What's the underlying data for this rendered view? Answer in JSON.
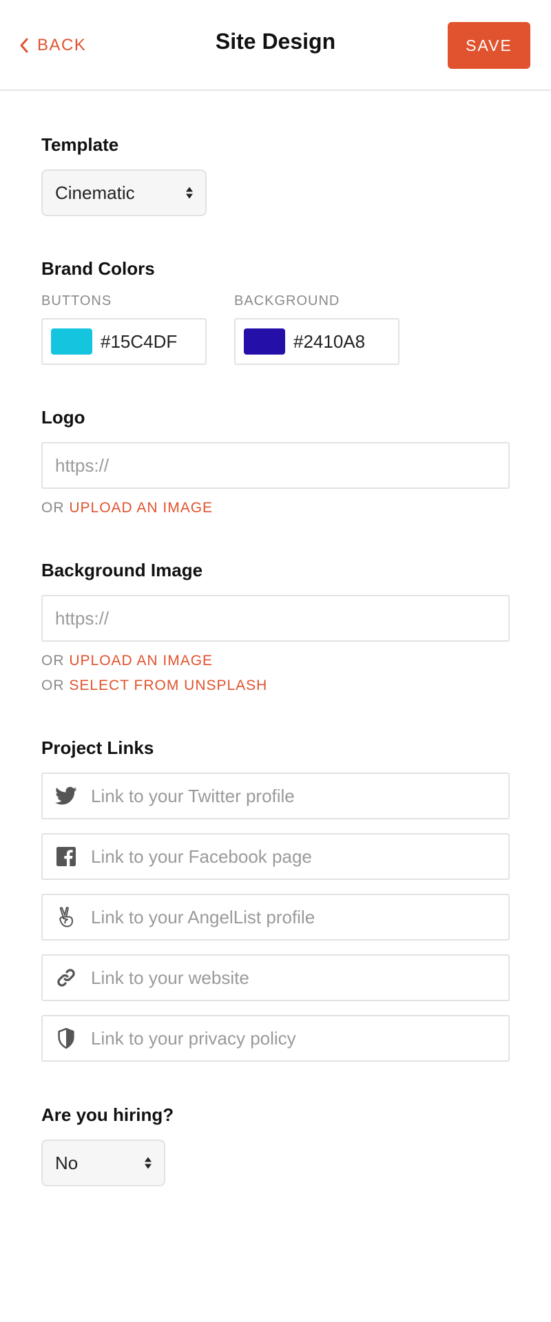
{
  "header": {
    "back_label": "BACK",
    "title": "Site Design",
    "save_label": "SAVE"
  },
  "template": {
    "title": "Template",
    "selected": "Cinematic"
  },
  "brand_colors": {
    "title": "Brand Colors",
    "buttons_label": "BUTTONS",
    "buttons_value": "#15C4DF",
    "buttons_swatch": "#15C4DF",
    "background_label": "BACKGROUND",
    "background_value": "#2410A8",
    "background_swatch": "#2410A8"
  },
  "logo": {
    "title": "Logo",
    "placeholder": "https://",
    "or_label": "OR",
    "upload_label": "UPLOAD AN IMAGE"
  },
  "background_image": {
    "title": "Background Image",
    "placeholder": "https://",
    "or_label": "OR",
    "upload_label": "UPLOAD AN IMAGE",
    "unsplash_label": "SELECT FROM UNSPLASH"
  },
  "project_links": {
    "title": "Project Links",
    "items": [
      {
        "icon": "twitter-icon",
        "placeholder": "Link to your Twitter profile"
      },
      {
        "icon": "facebook-icon",
        "placeholder": "Link to your Facebook page"
      },
      {
        "icon": "angellist-icon",
        "placeholder": "Link to your AngelList profile"
      },
      {
        "icon": "link-icon",
        "placeholder": "Link to your website"
      },
      {
        "icon": "shield-icon",
        "placeholder": "Link to your privacy policy"
      }
    ]
  },
  "hiring": {
    "title": "Are you hiring?",
    "selected": "No"
  },
  "colors": {
    "accent": "#E0532E",
    "muted_text": "#8A8A8A",
    "placeholder_text": "#9A9A9A",
    "border": "#E2E2E2"
  }
}
